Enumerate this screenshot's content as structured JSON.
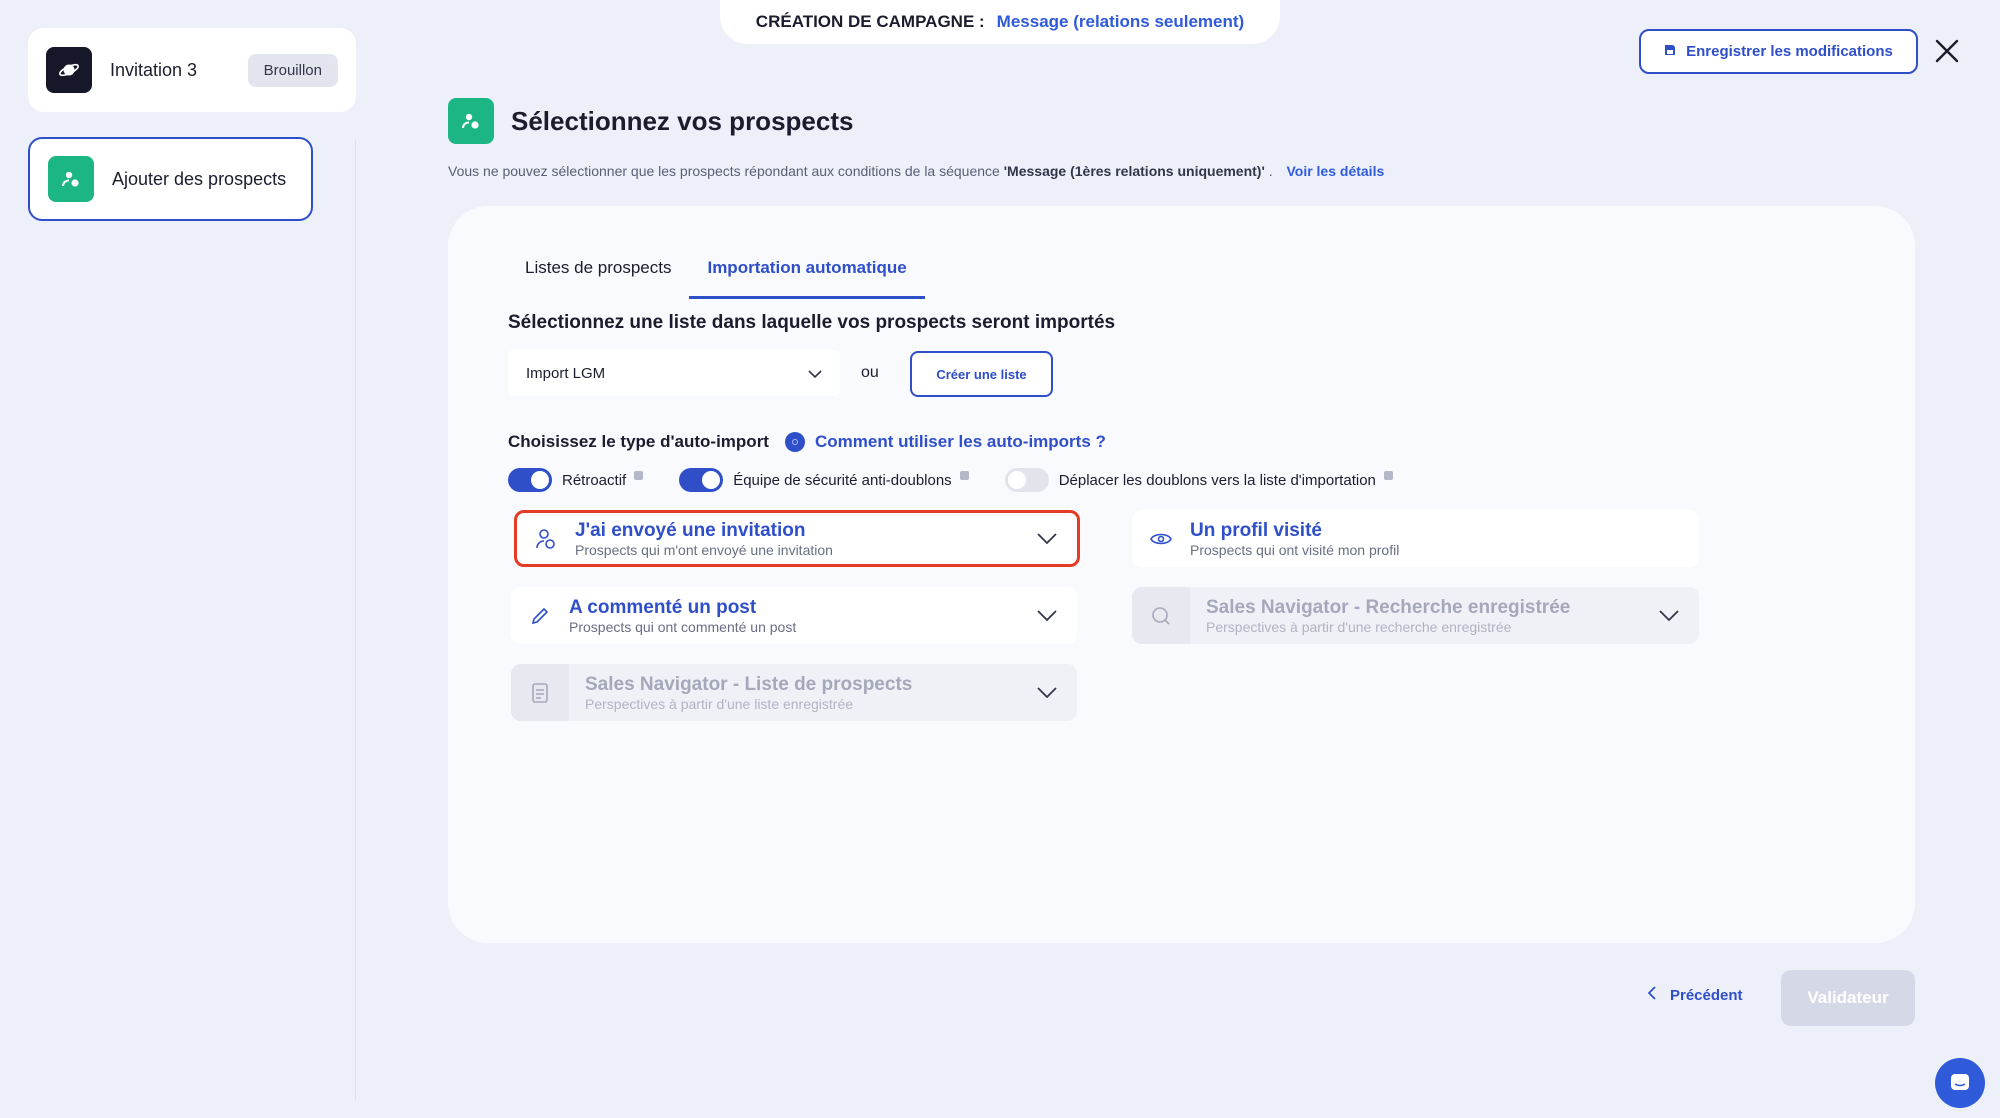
{
  "banner": {
    "label": "CRÉATION DE CAMPAGNE :",
    "value": "Message (relations seulement)"
  },
  "toolbar": {
    "save_label": "Enregistrer les modifications"
  },
  "sidebar": {
    "campaign": {
      "name": "Invitation 3",
      "status": "Brouillon"
    },
    "step": {
      "label": "Ajouter des prospects"
    }
  },
  "header": {
    "title": "Sélectionnez vos prospects",
    "subtitle_pre": "Vous ne pouvez sélectionner que les prospects répondant aux conditions de la séquence",
    "subtitle_bold": "'Message (1ères relations uniquement)'",
    "subtitle_post": ".",
    "details_link": "Voir les détails"
  },
  "tabs": [
    {
      "label": "Listes de prospects",
      "active": false
    },
    {
      "label": "Importation automatique",
      "active": true
    }
  ],
  "import": {
    "heading": "Sélectionnez une liste dans laquelle vos prospects seront importés",
    "selected_list": "Import LGM",
    "or_label": "ou",
    "create_label": "Créer une liste"
  },
  "autoimport": {
    "heading": "Choisissez le type d'auto-import",
    "help_link": "Comment utiliser les auto-imports ?",
    "toggles": [
      {
        "label": "Rétroactif",
        "on": true
      },
      {
        "label": "Équipe de sécurité anti-doublons",
        "on": true
      },
      {
        "label": "Déplacer les doublons vers la liste d'importation",
        "on": false
      }
    ]
  },
  "options": [
    {
      "title": "J'ai envoyé une invitation",
      "desc": "Prospects qui m'ont envoyé une invitation",
      "icon": "user-invite-icon",
      "disabled": false
    },
    {
      "title": "Un profil visité",
      "desc": "Prospects qui ont visité mon profil",
      "icon": "eye-icon",
      "disabled": false
    },
    {
      "title": "A commenté un post",
      "desc": "Prospects qui ont commenté un post",
      "icon": "pencil-icon",
      "disabled": false
    },
    {
      "title": "Sales Navigator - Recherche enregistrée",
      "desc": "Perspectives à partir d'une recherche enregistrée",
      "icon": "search-icon",
      "disabled": true
    },
    {
      "title": "Sales Navigator - Liste de prospects",
      "desc": "Perspectives à partir d'une liste enregistrée",
      "icon": "document-icon",
      "disabled": true
    }
  ],
  "nav": {
    "prev_label": "Précédent",
    "next_label": "Validateur"
  },
  "colors": {
    "accent": "#2f4fc9",
    "green": "#1cb584",
    "highlight": "#e53a24"
  }
}
